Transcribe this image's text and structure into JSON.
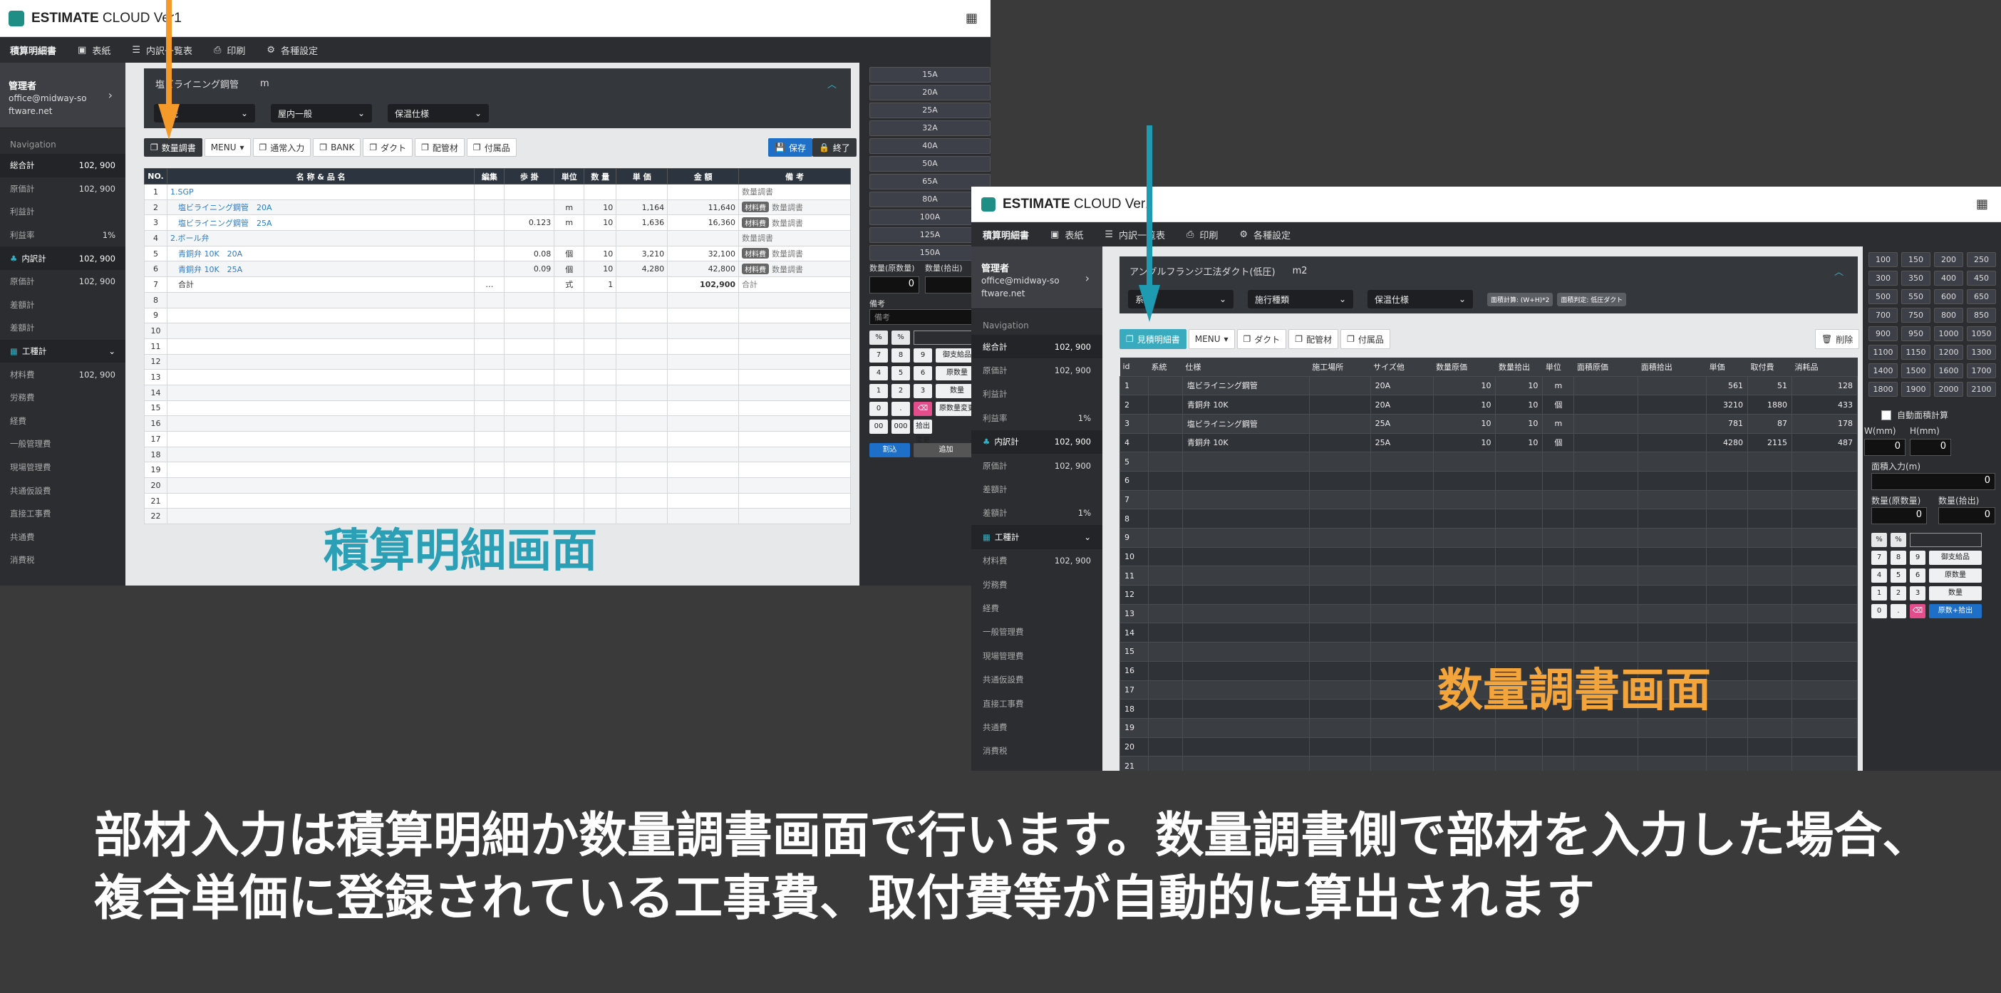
{
  "left": {
    "app_title_a": "ESTIMATE",
    "app_title_b": " CLOUD Ver1",
    "nav": {
      "brand": "積算明細書",
      "cover": "表紙",
      "list": "内訳一覧表",
      "print": "印刷",
      "settings": "各種設定"
    },
    "profile": {
      "name": "管理者",
      "email": "office@midway-software.net"
    },
    "sidebar_heading": "Navigation",
    "sidebar": [
      {
        "label": "総合計",
        "value": "102, 900"
      },
      {
        "label": "原価計",
        "value": "102, 900"
      },
      {
        "label": "利益計",
        "value": ""
      },
      {
        "label": "利益率",
        "value": "1%"
      },
      {
        "label": "内訳計",
        "value": "102, 900"
      },
      {
        "label": "原価計",
        "value": "102, 900"
      },
      {
        "label": "差額計",
        "value": ""
      },
      {
        "label": "差額計",
        "value": ""
      },
      {
        "label": "工種計",
        "value": ""
      },
      {
        "label": "材料費",
        "value": "102, 900"
      },
      {
        "label": "労務費",
        "value": ""
      },
      {
        "label": "経費",
        "value": ""
      },
      {
        "label": "一般管理費",
        "value": ""
      },
      {
        "label": "現場管理費",
        "value": ""
      },
      {
        "label": "共通仮設費",
        "value": ""
      },
      {
        "label": "直接工事費",
        "value": ""
      },
      {
        "label": "共通費",
        "value": ""
      },
      {
        "label": "消費税",
        "value": ""
      }
    ],
    "panel_title": "塩ビライニング鋼管",
    "panel_unit": "m",
    "dropdowns": [
      "系統",
      "屋内一般",
      "保温仕様"
    ],
    "toolbar": [
      "数量調書",
      "MENU",
      "通常入力",
      "BANK",
      "ダクト",
      "配管材",
      "付属品"
    ],
    "save": "保存",
    "end": "終了",
    "headers": [
      "NO.",
      "名 称 & 品 名",
      "編集",
      "歩 掛",
      "単位",
      "数 量",
      "単 価",
      "金 額",
      "備 考"
    ],
    "rows": [
      {
        "no": "1",
        "name": "1.SGP",
        "link": true,
        "edit": "",
        "rate": "",
        "unit": "",
        "qty": "",
        "price": "",
        "amount": "",
        "tag": "",
        "note": "数量調書"
      },
      {
        "no": "2",
        "name": "　塩ビライニング鋼管　20A",
        "link": true,
        "edit": "",
        "rate": "",
        "unit": "m",
        "qty": "10",
        "price": "1,164",
        "amount": "11,640",
        "tag": "材料費",
        "note": "数量調書"
      },
      {
        "no": "3",
        "name": "　塩ビライニング鋼管　25A",
        "link": true,
        "edit": "",
        "rate": "0.123",
        "unit": "m",
        "qty": "10",
        "price": "1,636",
        "amount": "16,360",
        "tag": "材料費",
        "note": "数量調書"
      },
      {
        "no": "4",
        "name": "2.ボール弁",
        "link": true,
        "edit": "",
        "rate": "",
        "unit": "",
        "qty": "",
        "price": "",
        "amount": "",
        "tag": "",
        "note": "数量調書"
      },
      {
        "no": "5",
        "name": "　青銅弁 10K　20A",
        "link": true,
        "edit": "",
        "rate": "0.08",
        "unit": "個",
        "qty": "10",
        "price": "3,210",
        "amount": "32,100",
        "tag": "材料費",
        "note": "数量調書"
      },
      {
        "no": "6",
        "name": "　青銅弁 10K　25A",
        "link": true,
        "edit": "",
        "rate": "0.09",
        "unit": "個",
        "qty": "10",
        "price": "4,280",
        "amount": "42,800",
        "tag": "材料費",
        "note": "数量調書"
      },
      {
        "no": "7",
        "name": "　合計",
        "link": false,
        "edit": "…",
        "rate": "",
        "unit": "式",
        "qty": "1",
        "price": "",
        "amount": "102,900",
        "tag": "",
        "note": "合計"
      },
      {
        "no": "8"
      },
      {
        "no": "9"
      },
      {
        "no": "10"
      },
      {
        "no": "11"
      },
      {
        "no": "12"
      },
      {
        "no": "13"
      },
      {
        "no": "14"
      },
      {
        "no": "15"
      },
      {
        "no": "16"
      },
      {
        "no": "17"
      },
      {
        "no": "18"
      },
      {
        "no": "19"
      },
      {
        "no": "20"
      },
      {
        "no": "21"
      },
      {
        "no": "22"
      }
    ],
    "sizes": [
      "15A",
      "20A",
      "25A",
      "32A",
      "40A",
      "50A",
      "65A",
      "80A",
      "100A",
      "125A",
      "150A"
    ],
    "qty_labels": [
      "数量(原数量)",
      "数量(拾出)"
    ],
    "qty_value": "0",
    "remark_label": "備考",
    "remark_placeholder": "備考",
    "keys": [
      "%",
      "%",
      "7",
      "8",
      "9",
      "御支給品",
      "4",
      "5",
      "6",
      "原数量",
      "1",
      "2",
      "3",
      "数量",
      "0",
      ".",
      "⌫",
      "原数量変更",
      "00",
      "000",
      "拾出変更"
    ],
    "calc_btn": "割込",
    "add_btn": "追加",
    "caption": "積算明細画面"
  },
  "right": {
    "app_title_a": "ESTIMATE",
    "app_title_b": " CLOUD Ver1",
    "nav": {
      "brand": "積算明細書",
      "cover": "表紙",
      "list": "内訳一覧表",
      "print": "印刷",
      "settings": "各種設定"
    },
    "profile": {
      "name": "管理者",
      "email": "office@midway-software.net"
    },
    "sidebar_heading": "Navigation",
    "sidebar": [
      {
        "label": "総合計",
        "value": "102, 900"
      },
      {
        "label": "原価計",
        "value": "102, 900"
      },
      {
        "label": "利益計",
        "value": ""
      },
      {
        "label": "利益率",
        "value": "1%"
      },
      {
        "label": "内訳計",
        "value": "102, 900"
      },
      {
        "label": "原価計",
        "value": "102, 900"
      },
      {
        "label": "差額計",
        "value": ""
      },
      {
        "label": "差額計",
        "value": "1%"
      },
      {
        "label": "工種計",
        "value": ""
      },
      {
        "label": "材料費",
        "value": "102, 900"
      },
      {
        "label": "労務費",
        "value": ""
      },
      {
        "label": "経費",
        "value": ""
      },
      {
        "label": "一般管理費",
        "value": ""
      },
      {
        "label": "現場管理費",
        "value": ""
      },
      {
        "label": "共通仮設費",
        "value": ""
      },
      {
        "label": "直接工事費",
        "value": ""
      },
      {
        "label": "共通費",
        "value": ""
      },
      {
        "label": "消費税",
        "value": ""
      }
    ],
    "panel_title": "アングルフランジ工法ダクト(低圧)",
    "panel_unit": "m2",
    "dropdowns": [
      "系統",
      "施行種類",
      "保温仕様"
    ],
    "formula_tags": [
      "面積計算: (W+H)*2",
      "面積判定: 低圧ダクト"
    ],
    "toolbar": [
      "見積明細書",
      "MENU",
      "ダクト",
      "配管材",
      "付属品"
    ],
    "delete": "削除",
    "headers": [
      "id",
      "系統",
      "仕様",
      "施工場所",
      "サイズ他",
      "数量原価",
      "数量拾出",
      "単位",
      "面積原価",
      "面積拾出",
      "単価",
      "取付費",
      "消耗品"
    ],
    "rows": [
      {
        "id": "1",
        "spec": "塩ビライニング鋼管",
        "size": "20A",
        "q1": "10",
        "q2": "10",
        "unit": "m",
        "price": "561",
        "fit": "51",
        "cons": "128"
      },
      {
        "id": "2",
        "spec": "青銅弁 10K",
        "size": "20A",
        "q1": "10",
        "q2": "10",
        "unit": "個",
        "price": "3210",
        "fit": "1880",
        "cons": "433"
      },
      {
        "id": "3",
        "spec": "塩ビライニング鋼管",
        "size": "25A",
        "q1": "10",
        "q2": "10",
        "unit": "m",
        "price": "781",
        "fit": "87",
        "cons": "178"
      },
      {
        "id": "4",
        "spec": "青銅弁 10K",
        "size": "25A",
        "q1": "10",
        "q2": "10",
        "unit": "個",
        "price": "4280",
        "fit": "2115",
        "cons": "487"
      },
      {
        "id": "5"
      },
      {
        "id": "6"
      },
      {
        "id": "7"
      },
      {
        "id": "8"
      },
      {
        "id": "9"
      },
      {
        "id": "10"
      },
      {
        "id": "11"
      },
      {
        "id": "12"
      },
      {
        "id": "13"
      },
      {
        "id": "14"
      },
      {
        "id": "15"
      },
      {
        "id": "16"
      },
      {
        "id": "17"
      },
      {
        "id": "18"
      },
      {
        "id": "19"
      },
      {
        "id": "20"
      },
      {
        "id": "21"
      }
    ],
    "sizes": [
      "100",
      "150",
      "200",
      "250",
      "300",
      "350",
      "400",
      "450",
      "500",
      "550",
      "600",
      "650",
      "700",
      "750",
      "800",
      "850",
      "900",
      "950",
      "1000",
      "1050",
      "1100",
      "1150",
      "1200",
      "1300",
      "1400",
      "1500",
      "1600",
      "1700",
      "1800",
      "1900",
      "2000",
      "2100"
    ],
    "auto_area": "自動面積計算",
    "w_label": "W(mm)",
    "h_label": "H(mm)",
    "w_value": "0",
    "h_value": "0",
    "area_label": "面積入力(m)",
    "area_value": "0",
    "qty_labels": [
      "数量(原数量)",
      "数量(拾出)"
    ],
    "qty_values": [
      "0",
      "0"
    ],
    "keys": [
      "%",
      "%",
      "7",
      "8",
      "9",
      "御支給品",
      "4",
      "5",
      "6",
      "原数量",
      "1",
      "2",
      "3",
      "数量",
      "0",
      ".",
      "⌫",
      "原数+拾出"
    ],
    "caption": "数量調書画面"
  },
  "description": "部材入力は積算明細か数量調書画面で行います。数量調書側で部材を入力した場合、複合単価に登録されている工事費、取付費等が自動的に算出されます",
  "colors": {
    "background": "#3a3a3a",
    "teal_caption": "#2a9fb5",
    "orange_caption": "#f3a43a",
    "orange_arrow": "#f39a2a",
    "teal_arrow": "#1e9bb0"
  }
}
